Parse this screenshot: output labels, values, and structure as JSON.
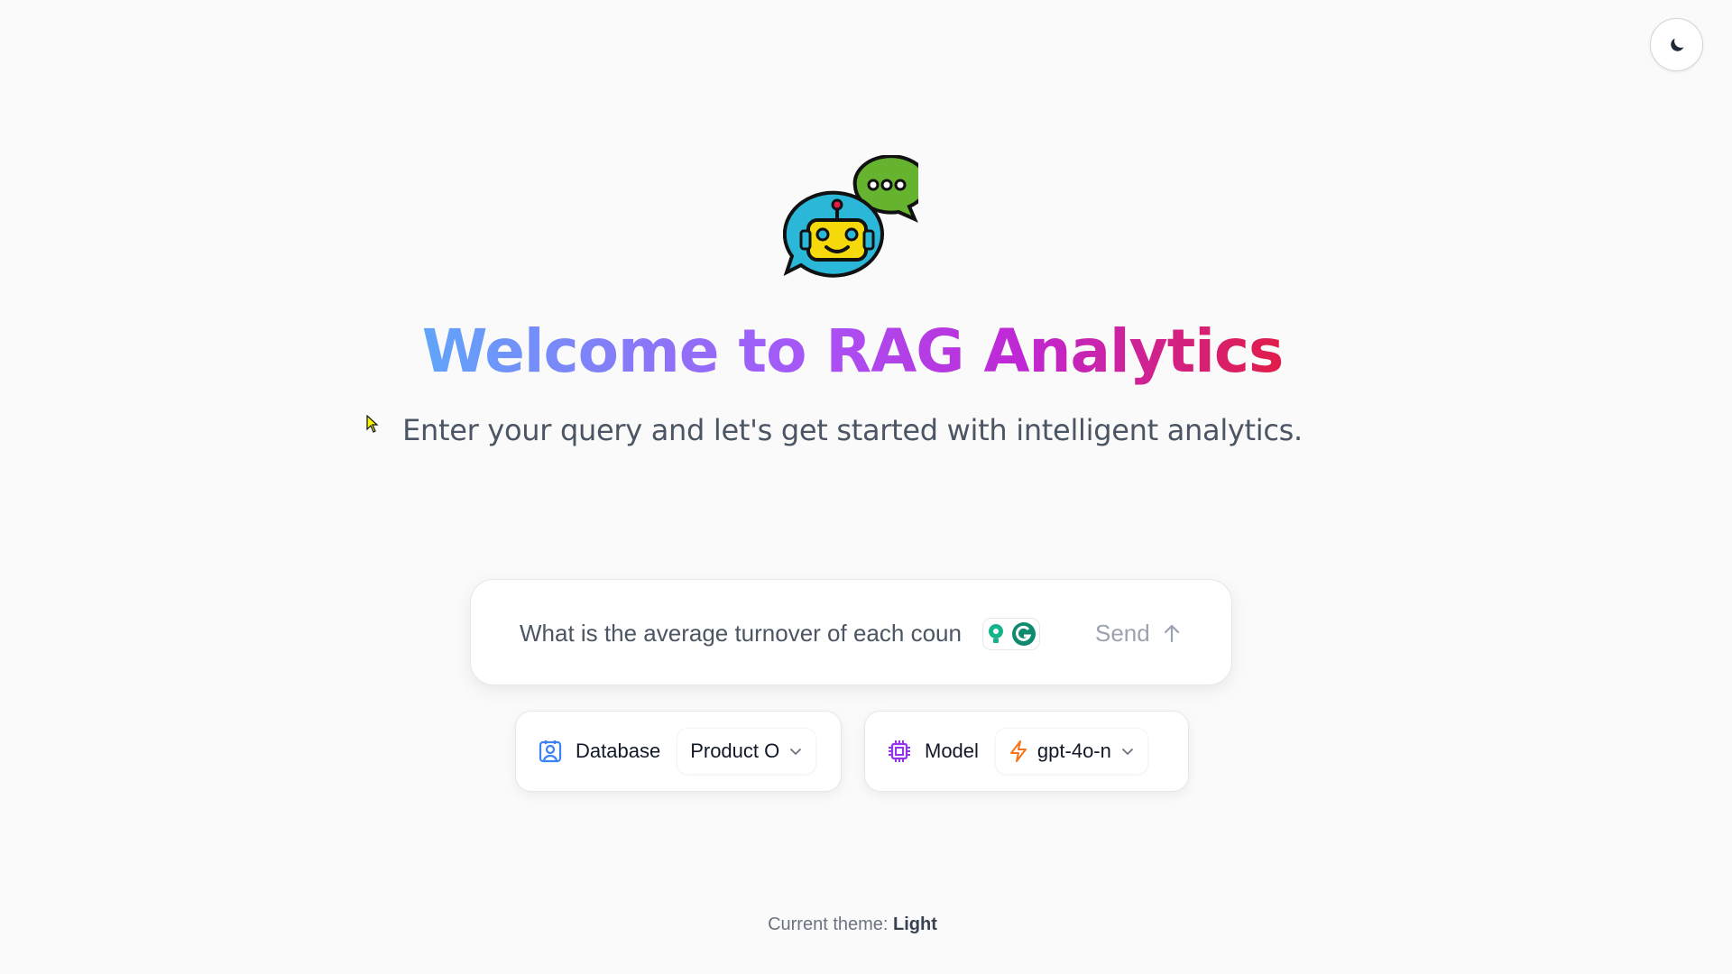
{
  "theme_toggle": {
    "icon": "moon-icon"
  },
  "logo": {
    "icon": "robot-chat-icon"
  },
  "hero": {
    "title": "Welcome to RAG Analytics",
    "subtitle": "Enter your query and let's get started with intelligent analytics."
  },
  "query": {
    "value": "What is the average turnover of each coun",
    "send_label": "Send",
    "send_icon": "arrow-up-icon"
  },
  "database": {
    "label": "Database",
    "selected": "Product O",
    "icon": "database-user-icon"
  },
  "model": {
    "label": "Model",
    "selected": "gpt-4o-n",
    "icon": "cpu-chip-icon",
    "value_icon": "lightning-icon"
  },
  "footer": {
    "prefix": "Current theme:",
    "theme": "Light"
  },
  "colors": {
    "title_gradient": [
      "#60a5fa",
      "#a855f7",
      "#c026d3",
      "#e11d48"
    ],
    "database_icon": "#3b82f6",
    "model_icon": "#9333ea",
    "lightning": "#f97316"
  }
}
